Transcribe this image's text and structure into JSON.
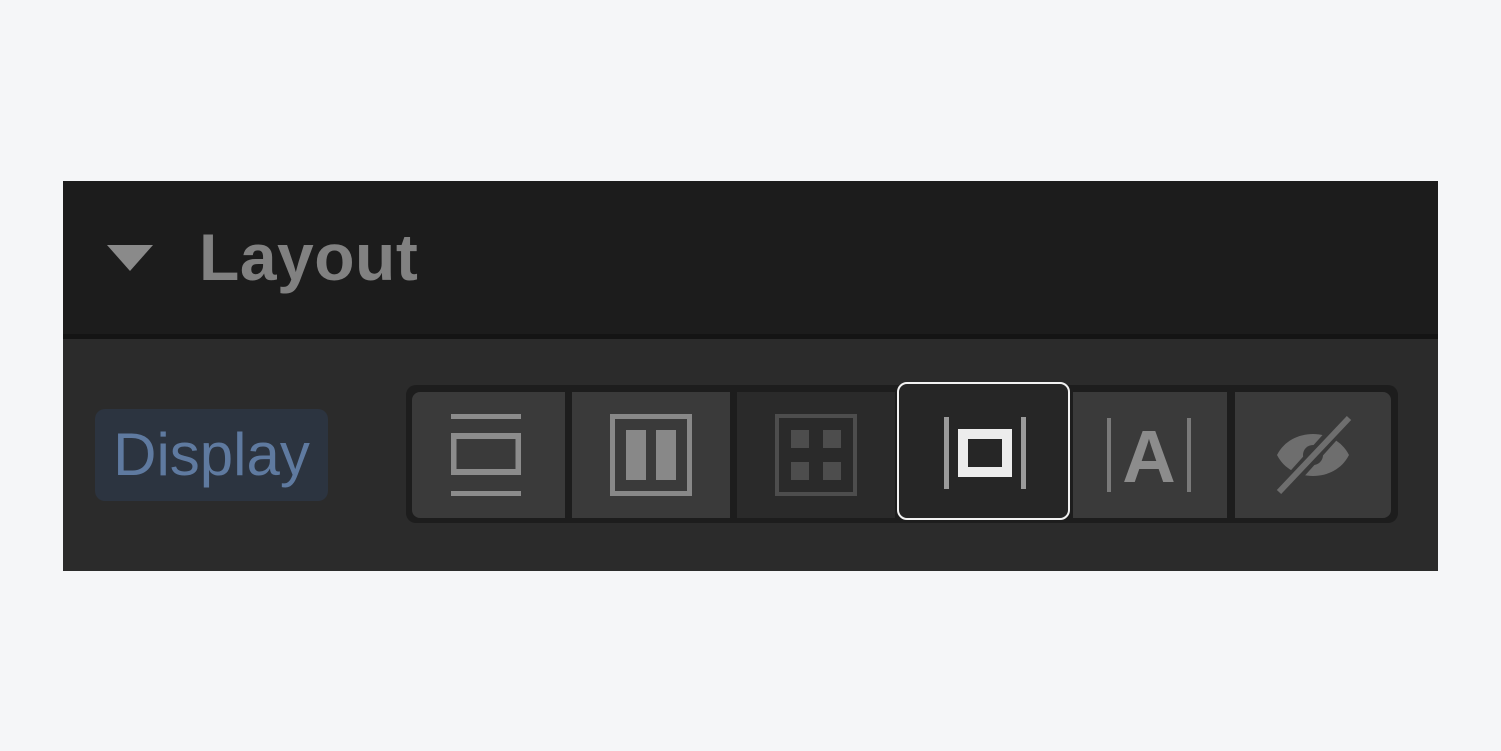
{
  "section": {
    "title": "Layout",
    "toggle_icon": "triangle-down-icon"
  },
  "display": {
    "label": "Display",
    "selected": "inline-block",
    "options": [
      {
        "key": "block",
        "icon": "display-block-icon"
      },
      {
        "key": "flex",
        "icon": "display-flex-icon"
      },
      {
        "key": "grid",
        "icon": "display-grid-icon"
      },
      {
        "key": "inline-block",
        "icon": "display-inline-block-icon"
      },
      {
        "key": "inline",
        "icon": "display-inline-icon",
        "glyph": "A"
      },
      {
        "key": "none",
        "icon": "display-none-icon"
      }
    ]
  },
  "colors": {
    "page_bg": "#f5f6f8",
    "header_bg": "#1c1c1c",
    "panel_bg": "#2b2b2b",
    "label_text": "#5f7aa0",
    "label_bg": "#2c3440",
    "selected_border": "#f2f2f2"
  }
}
